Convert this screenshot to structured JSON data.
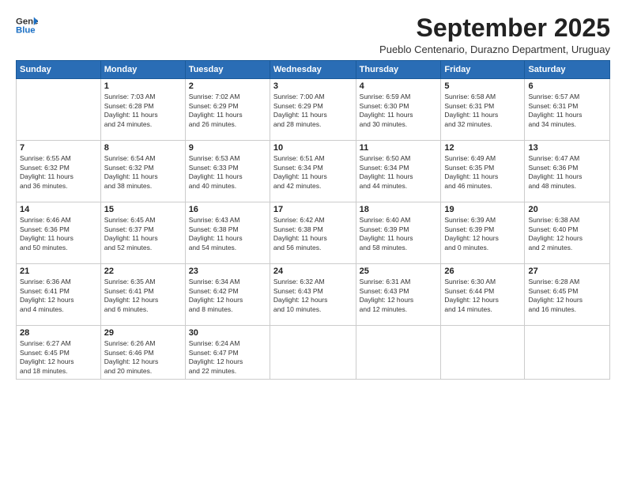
{
  "logo": {
    "line1": "General",
    "line2": "Blue"
  },
  "title": "September 2025",
  "subtitle": "Pueblo Centenario, Durazno Department, Uruguay",
  "headers": [
    "Sunday",
    "Monday",
    "Tuesday",
    "Wednesday",
    "Thursday",
    "Friday",
    "Saturday"
  ],
  "weeks": [
    [
      {
        "day": "",
        "content": ""
      },
      {
        "day": "1",
        "content": "Sunrise: 7:03 AM\nSunset: 6:28 PM\nDaylight: 11 hours\nand 24 minutes."
      },
      {
        "day": "2",
        "content": "Sunrise: 7:02 AM\nSunset: 6:29 PM\nDaylight: 11 hours\nand 26 minutes."
      },
      {
        "day": "3",
        "content": "Sunrise: 7:00 AM\nSunset: 6:29 PM\nDaylight: 11 hours\nand 28 minutes."
      },
      {
        "day": "4",
        "content": "Sunrise: 6:59 AM\nSunset: 6:30 PM\nDaylight: 11 hours\nand 30 minutes."
      },
      {
        "day": "5",
        "content": "Sunrise: 6:58 AM\nSunset: 6:31 PM\nDaylight: 11 hours\nand 32 minutes."
      },
      {
        "day": "6",
        "content": "Sunrise: 6:57 AM\nSunset: 6:31 PM\nDaylight: 11 hours\nand 34 minutes."
      }
    ],
    [
      {
        "day": "7",
        "content": "Sunrise: 6:55 AM\nSunset: 6:32 PM\nDaylight: 11 hours\nand 36 minutes."
      },
      {
        "day": "8",
        "content": "Sunrise: 6:54 AM\nSunset: 6:32 PM\nDaylight: 11 hours\nand 38 minutes."
      },
      {
        "day": "9",
        "content": "Sunrise: 6:53 AM\nSunset: 6:33 PM\nDaylight: 11 hours\nand 40 minutes."
      },
      {
        "day": "10",
        "content": "Sunrise: 6:51 AM\nSunset: 6:34 PM\nDaylight: 11 hours\nand 42 minutes."
      },
      {
        "day": "11",
        "content": "Sunrise: 6:50 AM\nSunset: 6:34 PM\nDaylight: 11 hours\nand 44 minutes."
      },
      {
        "day": "12",
        "content": "Sunrise: 6:49 AM\nSunset: 6:35 PM\nDaylight: 11 hours\nand 46 minutes."
      },
      {
        "day": "13",
        "content": "Sunrise: 6:47 AM\nSunset: 6:36 PM\nDaylight: 11 hours\nand 48 minutes."
      }
    ],
    [
      {
        "day": "14",
        "content": "Sunrise: 6:46 AM\nSunset: 6:36 PM\nDaylight: 11 hours\nand 50 minutes."
      },
      {
        "day": "15",
        "content": "Sunrise: 6:45 AM\nSunset: 6:37 PM\nDaylight: 11 hours\nand 52 minutes."
      },
      {
        "day": "16",
        "content": "Sunrise: 6:43 AM\nSunset: 6:38 PM\nDaylight: 11 hours\nand 54 minutes."
      },
      {
        "day": "17",
        "content": "Sunrise: 6:42 AM\nSunset: 6:38 PM\nDaylight: 11 hours\nand 56 minutes."
      },
      {
        "day": "18",
        "content": "Sunrise: 6:40 AM\nSunset: 6:39 PM\nDaylight: 11 hours\nand 58 minutes."
      },
      {
        "day": "19",
        "content": "Sunrise: 6:39 AM\nSunset: 6:39 PM\nDaylight: 12 hours\nand 0 minutes."
      },
      {
        "day": "20",
        "content": "Sunrise: 6:38 AM\nSunset: 6:40 PM\nDaylight: 12 hours\nand 2 minutes."
      }
    ],
    [
      {
        "day": "21",
        "content": "Sunrise: 6:36 AM\nSunset: 6:41 PM\nDaylight: 12 hours\nand 4 minutes."
      },
      {
        "day": "22",
        "content": "Sunrise: 6:35 AM\nSunset: 6:41 PM\nDaylight: 12 hours\nand 6 minutes."
      },
      {
        "day": "23",
        "content": "Sunrise: 6:34 AM\nSunset: 6:42 PM\nDaylight: 12 hours\nand 8 minutes."
      },
      {
        "day": "24",
        "content": "Sunrise: 6:32 AM\nSunset: 6:43 PM\nDaylight: 12 hours\nand 10 minutes."
      },
      {
        "day": "25",
        "content": "Sunrise: 6:31 AM\nSunset: 6:43 PM\nDaylight: 12 hours\nand 12 minutes."
      },
      {
        "day": "26",
        "content": "Sunrise: 6:30 AM\nSunset: 6:44 PM\nDaylight: 12 hours\nand 14 minutes."
      },
      {
        "day": "27",
        "content": "Sunrise: 6:28 AM\nSunset: 6:45 PM\nDaylight: 12 hours\nand 16 minutes."
      }
    ],
    [
      {
        "day": "28",
        "content": "Sunrise: 6:27 AM\nSunset: 6:45 PM\nDaylight: 12 hours\nand 18 minutes."
      },
      {
        "day": "29",
        "content": "Sunrise: 6:26 AM\nSunset: 6:46 PM\nDaylight: 12 hours\nand 20 minutes."
      },
      {
        "day": "30",
        "content": "Sunrise: 6:24 AM\nSunset: 6:47 PM\nDaylight: 12 hours\nand 22 minutes."
      },
      {
        "day": "",
        "content": ""
      },
      {
        "day": "",
        "content": ""
      },
      {
        "day": "",
        "content": ""
      },
      {
        "day": "",
        "content": ""
      }
    ]
  ]
}
